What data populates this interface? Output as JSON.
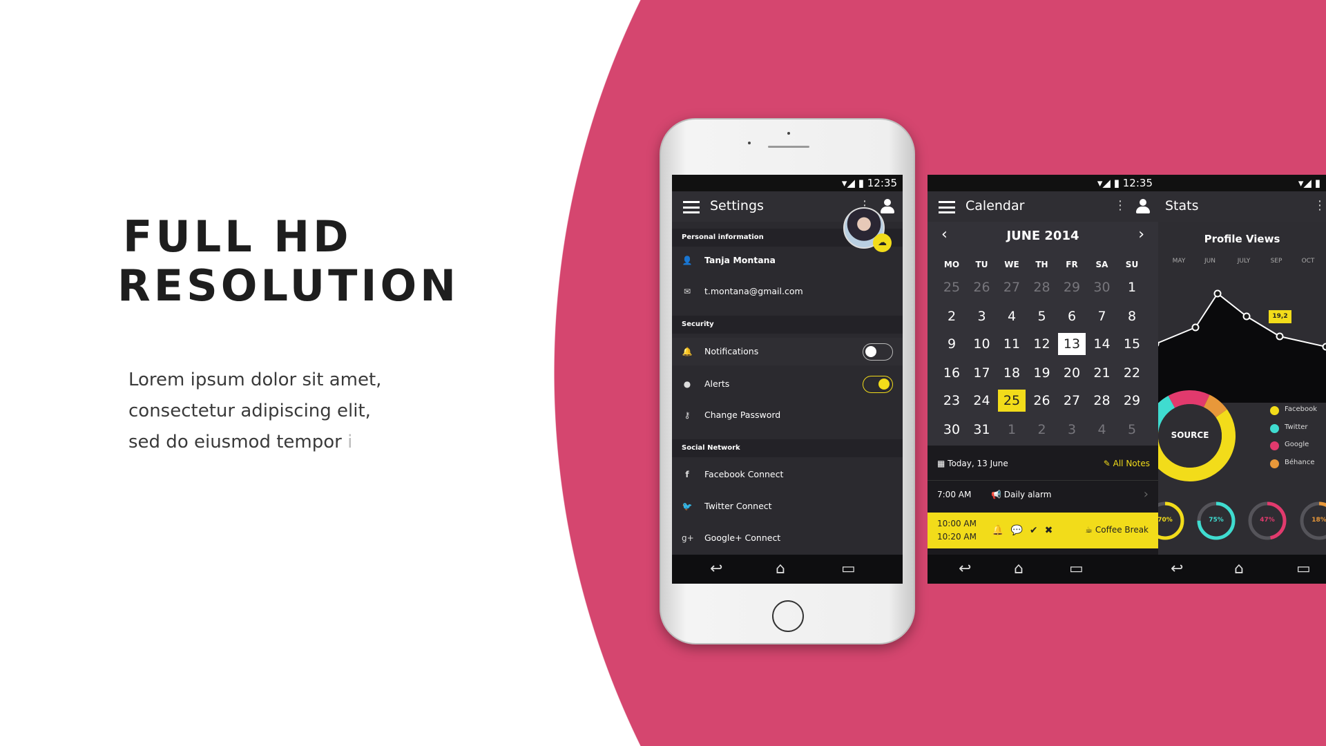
{
  "headline": {
    "line1": "FULL HD",
    "line2": "RESOLUTION"
  },
  "body": {
    "line1": "Lorem ipsum dolor sit amet,",
    "line2": "consectetur adipiscing elit,",
    "line3": "sed do eiusmod tempor",
    "fade": "i"
  },
  "colors": {
    "background_pink": "#d5466f",
    "accent_yellow": "#f2dc1a",
    "cyan": "#3fdcd0",
    "pink": "#e23a6d",
    "orange": "#e8983a"
  },
  "status": {
    "time": "12:35"
  },
  "settings": {
    "title": "Settings",
    "personal_header": "Personal information",
    "name": "Tanja Montana",
    "email": "t.montana@gmail.com",
    "security_header": "Security",
    "notifications": "Notifications",
    "notifications_on": false,
    "alerts": "Alerts",
    "alerts_on": true,
    "change_password": "Change Password",
    "social_header": "Social Network",
    "facebook": "Facebook Connect",
    "twitter": "Twitter Connect",
    "google": "Google+ Connect"
  },
  "calendar": {
    "title": "Calendar",
    "month": "JUNE 2014",
    "weekdays": [
      "MO",
      "TU",
      "WE",
      "TH",
      "FR",
      "SA",
      "SU"
    ],
    "weeks": [
      [
        25,
        26,
        27,
        28,
        29,
        30,
        1
      ],
      [
        2,
        3,
        4,
        5,
        6,
        7,
        8
      ],
      [
        9,
        10,
        11,
        12,
        13,
        14,
        15
      ],
      [
        16,
        17,
        18,
        19,
        20,
        21,
        22
      ],
      [
        23,
        24,
        25,
        26,
        27,
        28,
        29
      ],
      [
        30,
        31,
        1,
        2,
        3,
        4,
        5
      ]
    ],
    "today": 13,
    "selected": 25,
    "today_label": "Today, 13 June",
    "all_notes": "All Notes",
    "events": [
      {
        "time": "7:00 AM",
        "title": "Daily alarm"
      },
      {
        "time_start": "10:00 AM",
        "time_end": "10:20 AM",
        "title": "Coffee Break"
      }
    ]
  },
  "stats": {
    "title": "Stats",
    "chart_title": "Profile Views",
    "months": [
      "MAY",
      "JUN",
      "JULY",
      "SEP",
      "OCT"
    ],
    "tooltip": "19,2",
    "donut_label": "SOURCE",
    "legend": [
      {
        "label": "Facebook",
        "color": "#f2dc1a"
      },
      {
        "label": "Twitter",
        "color": "#3fdcd0"
      },
      {
        "label": "Google",
        "color": "#e23a6d"
      },
      {
        "label": "Béhance",
        "color": "#e8983a"
      }
    ],
    "rings": [
      {
        "label": "70%",
        "value": 70,
        "color": "#f2dc1a"
      },
      {
        "label": "75%",
        "value": 75,
        "color": "#3fdcd0"
      },
      {
        "label": "47%",
        "value": 47,
        "color": "#e23a6d"
      },
      {
        "label": "18%",
        "value": 18,
        "color": "#e8983a"
      }
    ]
  }
}
